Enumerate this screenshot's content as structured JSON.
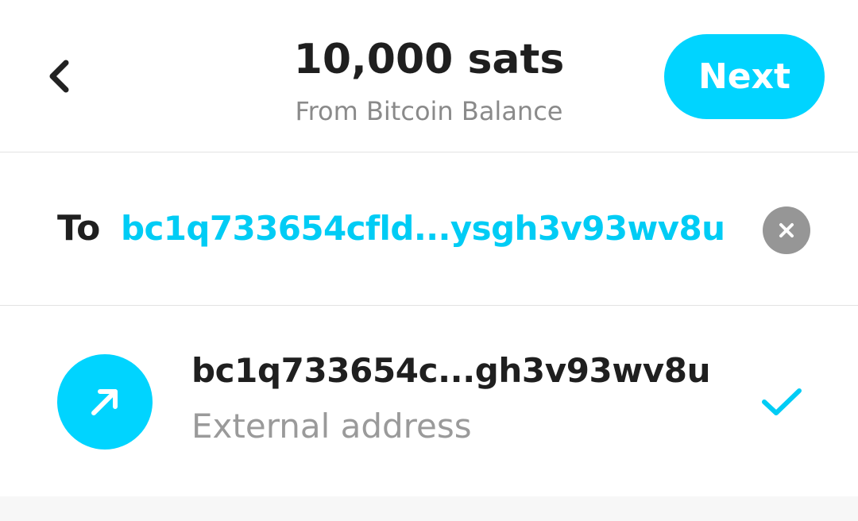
{
  "header": {
    "title": "10,000 sats",
    "subtitle": "From Bitcoin Balance",
    "next_label": "Next",
    "back_icon": "chevron-left-icon"
  },
  "to_row": {
    "label": "To",
    "address": "bc1q733654cfld...ysgh3v93wv8u",
    "clear_icon": "close-icon"
  },
  "result": {
    "title": "bc1q733654c...gh3v93wv8u",
    "subtitle": "External address",
    "avatar_icon": "arrow-up-right-icon",
    "selected_icon": "check-icon",
    "selected": true
  },
  "colors": {
    "accent": "#00d4ff",
    "text_primary": "#1f1f1f",
    "text_secondary": "#8a8a8a",
    "clear_bg": "#969696"
  }
}
